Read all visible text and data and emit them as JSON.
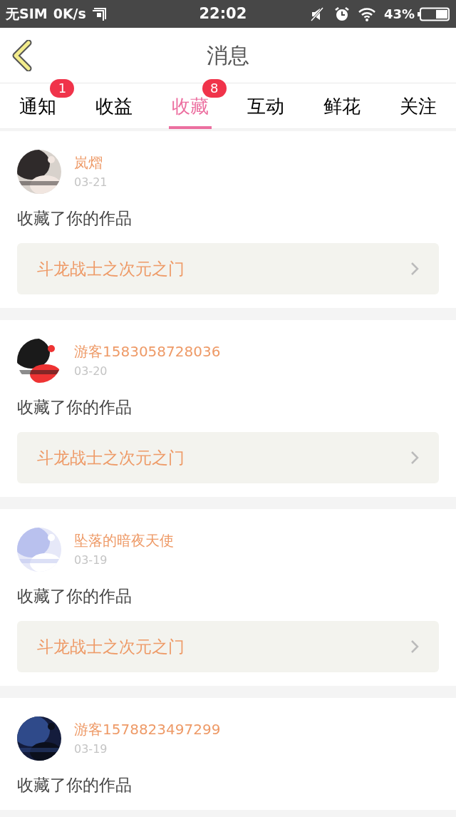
{
  "status_bar": {
    "carrier": "无SIM",
    "speed": "0K/s",
    "time": "22:02",
    "battery": "43%"
  },
  "header": {
    "title": "消息"
  },
  "tabs": [
    {
      "label": "通知",
      "selected": false,
      "badge": "1"
    },
    {
      "label": "收益",
      "selected": false
    },
    {
      "label": "收藏",
      "selected": true,
      "badge": "8"
    },
    {
      "label": "互动",
      "selected": false
    },
    {
      "label": "鲜花",
      "selected": false
    },
    {
      "label": "关注",
      "selected": false
    }
  ],
  "messages": [
    {
      "user": "岚熠",
      "date": "03-21",
      "action": "收藏了你的作品",
      "work": "斗龙战士之次元之门"
    },
    {
      "user": "游客1583058728036",
      "date": "03-20",
      "action": "收藏了你的作品",
      "work": "斗龙战士之次元之门"
    },
    {
      "user": "坠落的暗夜天使",
      "date": "03-19",
      "action": "收藏了你的作品",
      "work": "斗龙战士之次元之门"
    },
    {
      "user": "游客1578823497299",
      "date": "03-19",
      "action": "收藏了你的作品"
    }
  ]
}
